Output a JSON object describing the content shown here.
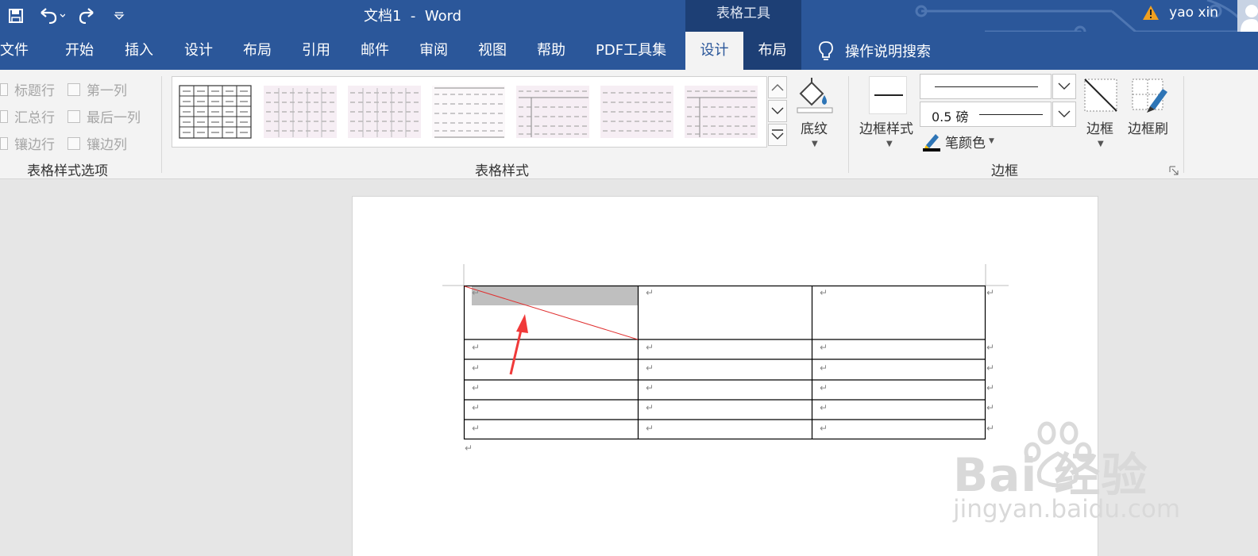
{
  "title_bar": {
    "doc_title": "文档1  -  Word",
    "context_tab_group": "表格工具",
    "user_name": "yao xin"
  },
  "tabs": [
    {
      "label": "文件"
    },
    {
      "label": "开始"
    },
    {
      "label": "插入"
    },
    {
      "label": "设计"
    },
    {
      "label": "布局"
    },
    {
      "label": "引用"
    },
    {
      "label": "邮件"
    },
    {
      "label": "审阅"
    },
    {
      "label": "视图"
    },
    {
      "label": "帮助"
    },
    {
      "label": "PDF工具集"
    },
    {
      "label": "设计",
      "active": true
    },
    {
      "label": "布局"
    }
  ],
  "tell_me": "操作说明搜索",
  "ribbon": {
    "style_options": {
      "items": [
        "标题行",
        "第一列",
        "汇总行",
        "最后一列",
        "镶边行",
        "镶边列"
      ],
      "label": "表格样式选项"
    },
    "table_styles": {
      "label": "表格样式",
      "shading_label": "底纹"
    },
    "borders": {
      "label": "边框",
      "border_styles_label": "边框样式",
      "pen_weight": "0.5 磅",
      "pen_color_label": "笔颜色",
      "borders_label": "边框",
      "border_painter_label": "边框刷"
    }
  },
  "paragraph_mark": "↵",
  "watermark": {
    "brand": "Bai  经验",
    "url": "jingyan.baidu.com"
  },
  "colors": {
    "word_blue": "#2b579a",
    "context_blue": "#1d3f75",
    "selection_gray": "#bfbfbf",
    "diagonal_red": "#e03030",
    "arrow_red": "#f03a3a",
    "warning_orange": "#f0a020"
  }
}
